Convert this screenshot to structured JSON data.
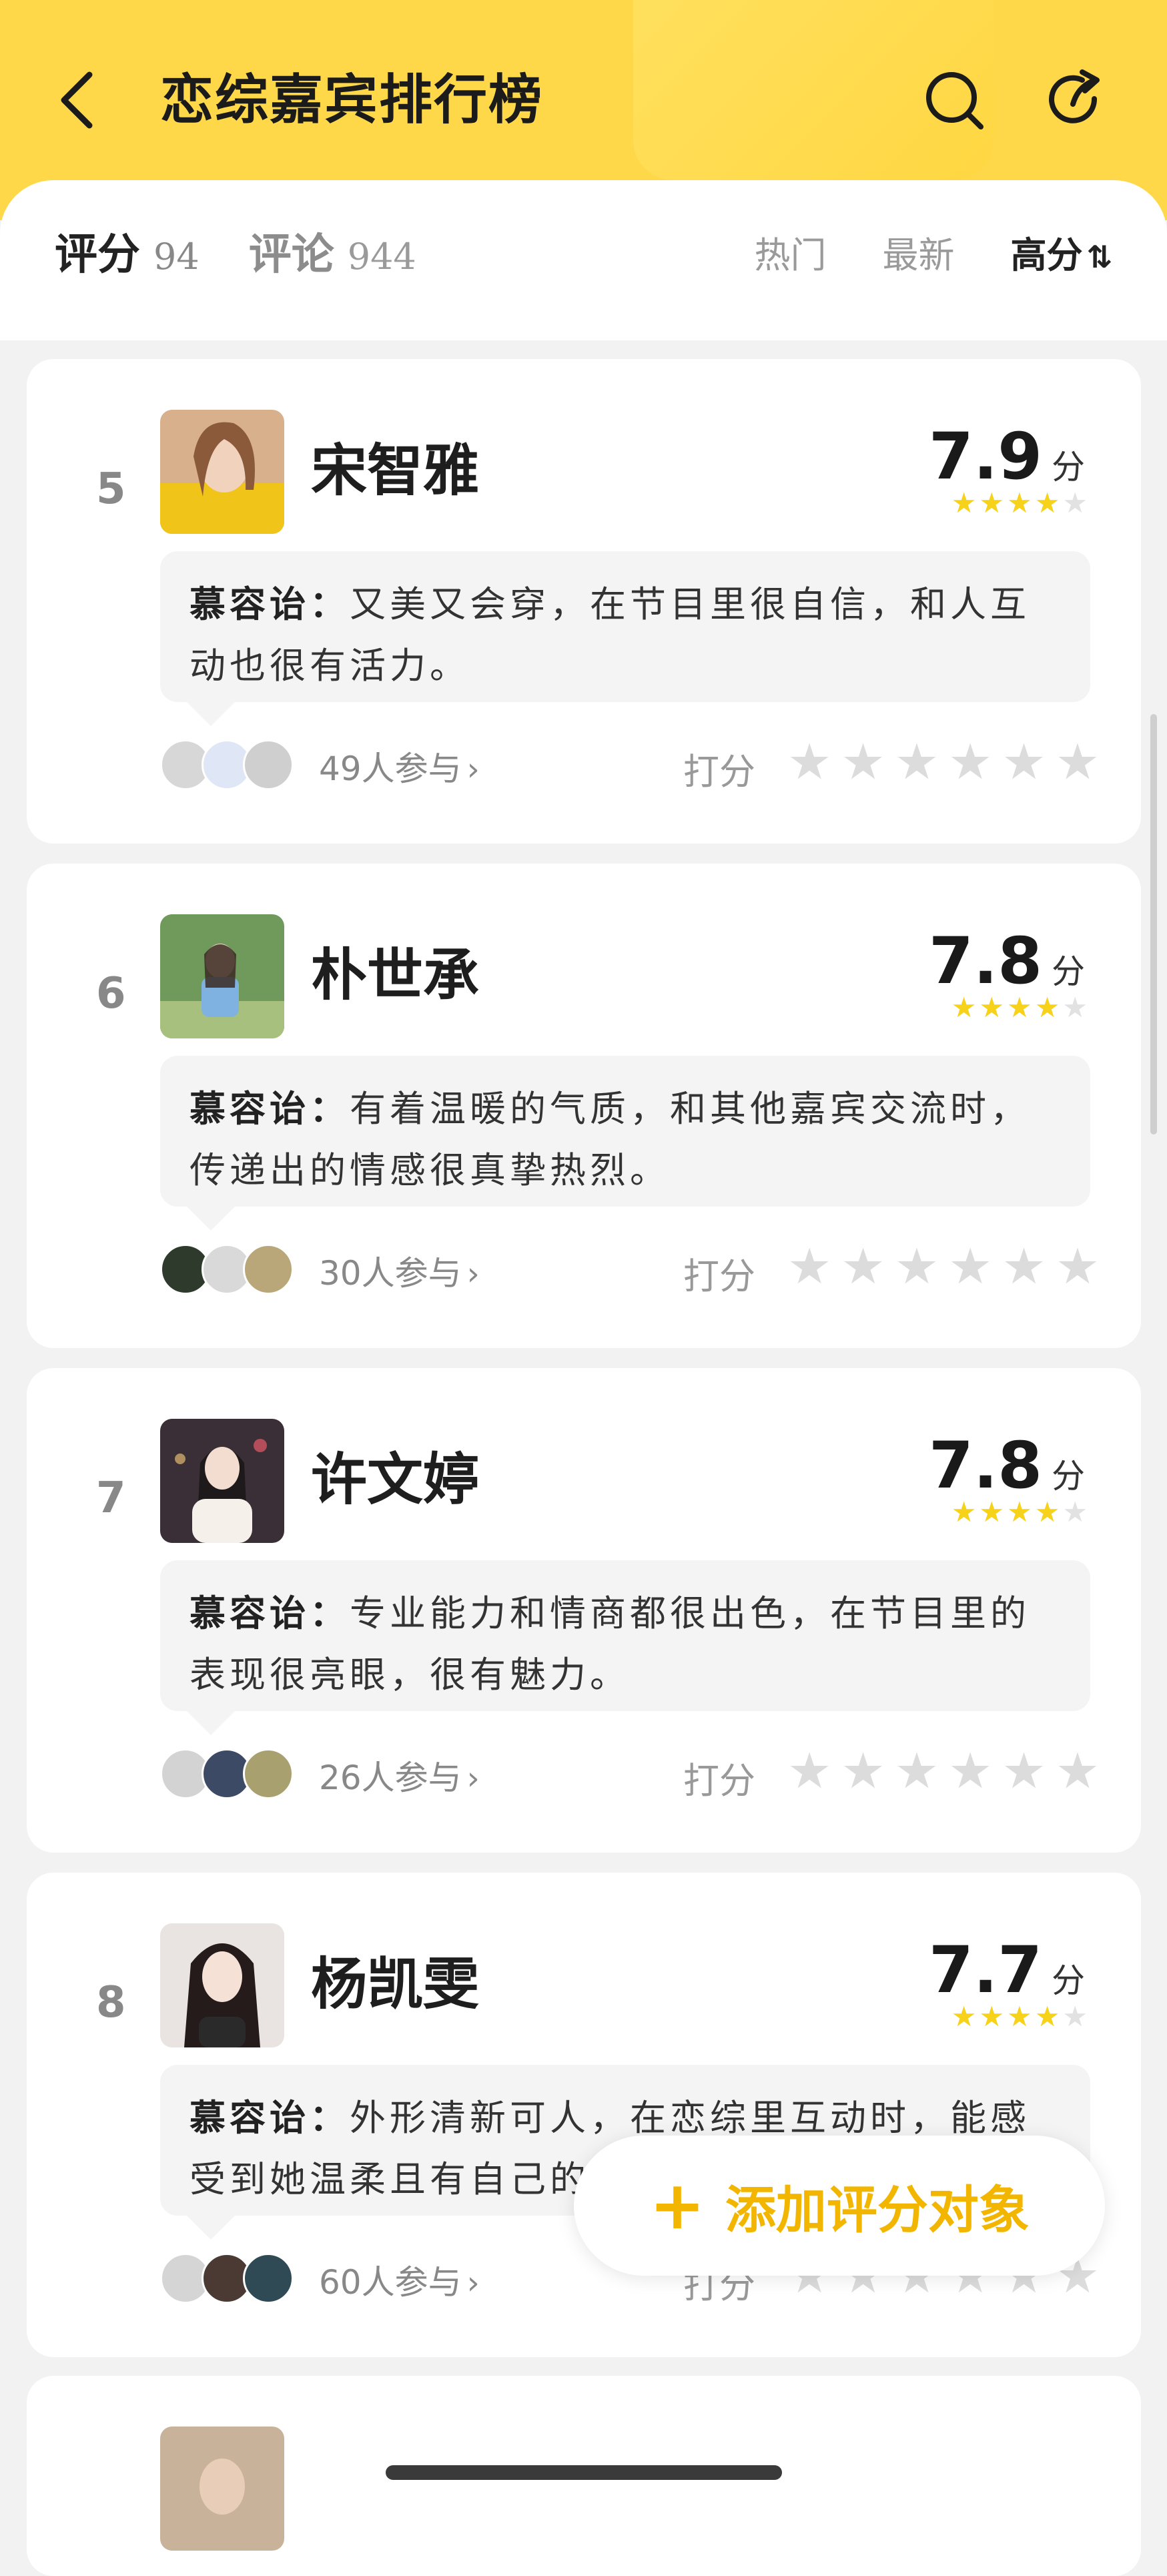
{
  "header": {
    "title": "恋综嘉宾排行榜",
    "bg_color": "#ffd84a"
  },
  "tabs": [
    {
      "label": "评分",
      "count": "94"
    },
    {
      "label": "评论",
      "count": "944"
    }
  ],
  "sorts": [
    {
      "label": "热门"
    },
    {
      "label": "最新"
    },
    {
      "label": "高分",
      "arrow": "⇅"
    }
  ],
  "cards": [
    {
      "rank": "5",
      "name": "宋智雅",
      "score": "7.9",
      "unit": "分",
      "stars_filled": 4,
      "author": "慕容诒",
      "colon": "：",
      "comment": "又美又会穿，在节目里很自信，和人互动也很有活力。",
      "participants": "49人参与",
      "rate_label": "打分"
    },
    {
      "rank": "6",
      "name": "朴世承",
      "score": "7.8",
      "unit": "分",
      "stars_filled": 4,
      "author": "慕容诒",
      "colon": "：",
      "comment": "有着温暖的气质，和其他嘉宾交流时，传递出的情感很真挚热烈。",
      "participants": "30人参与",
      "rate_label": "打分"
    },
    {
      "rank": "7",
      "name": "许文婷",
      "score": "7.8",
      "unit": "分",
      "stars_filled": 4,
      "author": "慕容诒",
      "colon": "：",
      "comment": "专业能力和情商都很出色，在节目里的表现很亮眼，很有魅力。",
      "participants": "26人参与",
      "rate_label": "打分"
    },
    {
      "rank": "8",
      "name": "杨凯雯",
      "score": "7.7",
      "unit": "分",
      "stars_filled": 4,
      "author": "慕容诒",
      "colon": "：",
      "comment": "外形清新可人，在恋综里互动时，能感受到她温柔且有自己的小",
      "participants": "60人参与",
      "rate_label": "打分"
    }
  ],
  "add_button": {
    "label": "添加评分对象",
    "color": "#f3b600"
  },
  "star_color": "#f7d21b"
}
